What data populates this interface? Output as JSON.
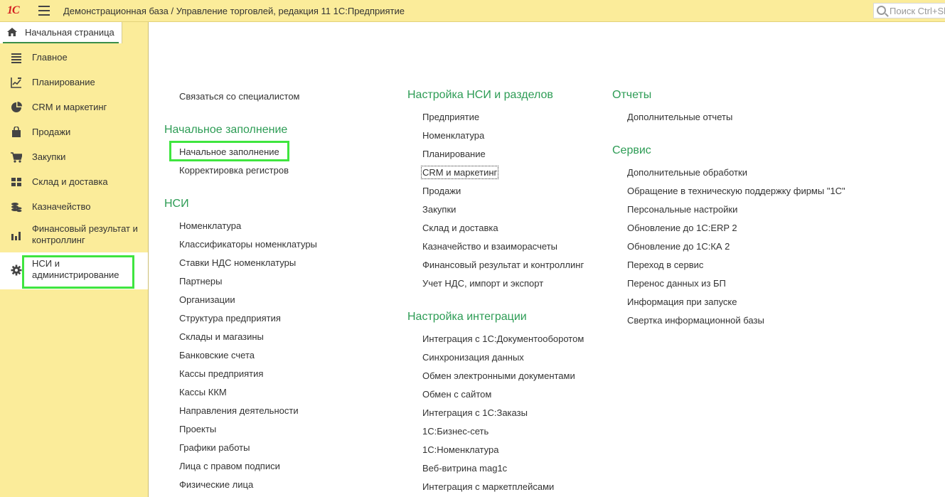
{
  "app": {
    "logo": "1С",
    "title": "Демонстрационная база / Управление торговлей, редакция 11 1С:Предприятие",
    "search_placeholder": "Поиск Ctrl+Shift+F"
  },
  "home_tab": {
    "label": "Начальная страница"
  },
  "sidebar": {
    "items": [
      {
        "label": "Главное",
        "icon": "menu-lines-icon"
      },
      {
        "label": "Планирование",
        "icon": "planning-chart-icon"
      },
      {
        "label": "CRM и маркетинг",
        "icon": "pie-chart-icon"
      },
      {
        "label": "Продажи",
        "icon": "shopping-bag-icon"
      },
      {
        "label": "Закупки",
        "icon": "cart-icon"
      },
      {
        "label": "Склад и доставка",
        "icon": "warehouse-grid-icon"
      },
      {
        "label": "Казначейство",
        "icon": "coins-icon"
      },
      {
        "label": "Финансовый результат и контроллинг",
        "icon": "bar-chart-icon"
      },
      {
        "label": "НСИ и администрирование",
        "icon": "gear-icon",
        "active": true
      }
    ]
  },
  "content": {
    "col1": {
      "top_link": "Связаться со специалистом",
      "groups": [
        {
          "title": "Начальное заполнение",
          "links": [
            "Начальное заполнение",
            "Корректировка регистров"
          ]
        },
        {
          "title": "НСИ",
          "links": [
            "Номенклатура",
            "Классификаторы номенклатуры",
            "Ставки НДС номенклатуры",
            "Партнеры",
            "Организации",
            "Структура предприятия",
            "Склады и магазины",
            "Банковские счета",
            "Кассы предприятия",
            "Кассы ККМ",
            "Направления деятельности",
            "Проекты",
            "Графики работы",
            "Лица с правом подписи",
            "Физические лица"
          ]
        }
      ]
    },
    "col2": {
      "groups": [
        {
          "title": "Настройка НСИ и разделов",
          "links": [
            "Предприятие",
            "Номенклатура",
            "Планирование",
            "CRM и маркетинг",
            "Продажи",
            "Закупки",
            "Склад и доставка",
            "Казначейство и взаиморасчеты",
            "Финансовый результат и контроллинг",
            "Учет НДС, импорт и экспорт"
          ]
        },
        {
          "title": "Настройка интеграции",
          "links": [
            "Интеграция с 1С:Документооборотом",
            "Синхронизация данных",
            "Обмен электронными документами",
            "Обмен с сайтом",
            "Интеграция с 1С:Заказы",
            "1С:Бизнес-сеть",
            "1С:Номенклатура",
            "Веб-витрина mag1c",
            "Интеграция с маркетплейсами"
          ]
        }
      ]
    },
    "col3": {
      "groups": [
        {
          "title": "Отчеты",
          "links": [
            "Дополнительные отчеты"
          ]
        },
        {
          "title": "Сервис",
          "links": [
            "Дополнительные обработки",
            "Обращение в техническую поддержку фирмы \"1С\"",
            "Персональные настройки",
            "Обновление до 1С:ERP 2",
            "Обновление до 1С:КА 2",
            "Переход в сервис",
            "Перенос данных из БП",
            "Информация при запуске",
            "Свертка информационной базы"
          ]
        }
      ]
    }
  },
  "colors": {
    "accent_green": "#2d9c55",
    "panel_yellow": "#fbec9a",
    "highlight_green": "#3fe53f"
  }
}
